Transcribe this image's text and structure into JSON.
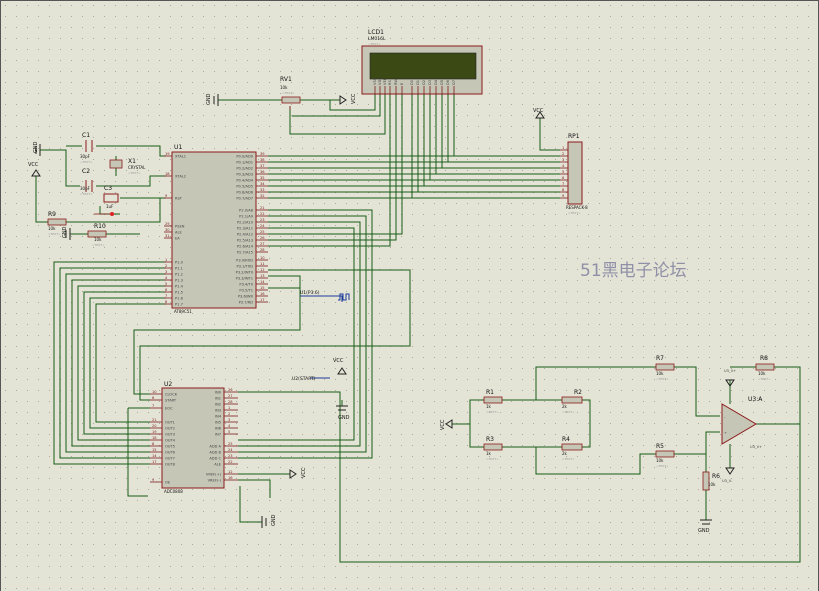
{
  "watermark": "51黑电子论坛",
  "placeholder_hint": "<TEXT>",
  "lcd": {
    "ref": "LCD1",
    "part": "LM016L",
    "pins": [
      "VSS",
      "VDD",
      "VEE",
      "RS",
      "RW",
      "E",
      "D0",
      "D1",
      "D2",
      "D3",
      "D4",
      "D5",
      "D6",
      "D7"
    ]
  },
  "rv1": {
    "ref": "RV1",
    "value": "10k"
  },
  "u1": {
    "ref": "U1",
    "part": "AT89C51",
    "left_pins": [
      {
        "num": "19",
        "name": "XTAL1"
      },
      {
        "num": "18",
        "name": "XTAL2"
      },
      {
        "num": "9",
        "name": "RST"
      },
      {
        "num": "29",
        "name": "PSEN"
      },
      {
        "num": "30",
        "name": "ALE"
      },
      {
        "num": "31",
        "name": "EA"
      },
      {
        "num": "1",
        "name": "P1.0"
      },
      {
        "num": "2",
        "name": "P1.1"
      },
      {
        "num": "3",
        "name": "P1.2"
      },
      {
        "num": "4",
        "name": "P1.3"
      },
      {
        "num": "5",
        "name": "P1.4"
      },
      {
        "num": "6",
        "name": "P1.5"
      },
      {
        "num": "7",
        "name": "P1.6"
      },
      {
        "num": "8",
        "name": "P1.7"
      }
    ],
    "right_pins": [
      {
        "num": "39",
        "name": "P0.0/AD0"
      },
      {
        "num": "38",
        "name": "P0.1/AD1"
      },
      {
        "num": "37",
        "name": "P0.2/AD2"
      },
      {
        "num": "36",
        "name": "P0.3/AD3"
      },
      {
        "num": "35",
        "name": "P0.4/AD4"
      },
      {
        "num": "34",
        "name": "P0.5/AD5"
      },
      {
        "num": "33",
        "name": "P0.6/AD6"
      },
      {
        "num": "32",
        "name": "P0.7/AD7"
      },
      {
        "num": "21",
        "name": "P2.0/A8"
      },
      {
        "num": "22",
        "name": "P2.1/A9"
      },
      {
        "num": "23",
        "name": "P2.2/A10"
      },
      {
        "num": "24",
        "name": "P2.3/A11"
      },
      {
        "num": "25",
        "name": "P2.4/A12"
      },
      {
        "num": "26",
        "name": "P2.5/A13"
      },
      {
        "num": "27",
        "name": "P2.6/A14"
      },
      {
        "num": "28",
        "name": "P2.7/A15"
      },
      {
        "num": "10",
        "name": "P3.0/RXD"
      },
      {
        "num": "11",
        "name": "P3.1/TXD"
      },
      {
        "num": "12",
        "name": "P3.2/INT0"
      },
      {
        "num": "13",
        "name": "P3.3/INT1"
      },
      {
        "num": "14",
        "name": "P3.4/T0"
      },
      {
        "num": "15",
        "name": "P3.5/T1"
      },
      {
        "num": "16",
        "name": "P3.6/WR"
      },
      {
        "num": "17",
        "name": "P3.7/RD"
      }
    ]
  },
  "u2": {
    "ref": "U2",
    "part": "ADC0808",
    "left_pins": [
      {
        "num": "10",
        "name": "CLOCK"
      },
      {
        "num": "6",
        "name": "START"
      },
      {
        "num": "7",
        "name": "EOC"
      },
      {
        "num": "21",
        "name": "OUT1"
      },
      {
        "num": "20",
        "name": "OUT2"
      },
      {
        "num": "19",
        "name": "OUT3"
      },
      {
        "num": "18",
        "name": "OUT4"
      },
      {
        "num": "8",
        "name": "OUT5"
      },
      {
        "num": "15",
        "name": "OUT6"
      },
      {
        "num": "14",
        "name": "OUT7"
      },
      {
        "num": "17",
        "name": "OUT8"
      },
      {
        "num": "9",
        "name": "OE"
      }
    ],
    "right_pins": [
      {
        "num": "26",
        "name": "IN0"
      },
      {
        "num": "27",
        "name": "IN1"
      },
      {
        "num": "28",
        "name": "IN2"
      },
      {
        "num": "1",
        "name": "IN3"
      },
      {
        "num": "2",
        "name": "IN4"
      },
      {
        "num": "3",
        "name": "IN5"
      },
      {
        "num": "4",
        "name": "IN6"
      },
      {
        "num": "5",
        "name": "IN7"
      },
      {
        "num": "25",
        "name": "ADD A"
      },
      {
        "num": "24",
        "name": "ADD B"
      },
      {
        "num": "23",
        "name": "ADD C"
      },
      {
        "num": "22",
        "name": "ALE"
      },
      {
        "num": "12",
        "name": "VREF(+)"
      },
      {
        "num": "16",
        "name": "VREF(-)"
      }
    ]
  },
  "rp1": {
    "ref": "RP1",
    "part": "RESPACK-8",
    "pins": [
      "1",
      "2",
      "3",
      "4",
      "5",
      "6",
      "7",
      "8",
      "9"
    ]
  },
  "components": {
    "c1": {
      "ref": "C1",
      "value": "30pF"
    },
    "c2": {
      "ref": "C2",
      "value": "30pF"
    },
    "c3": {
      "ref": "C3",
      "value": "1uF"
    },
    "x1": {
      "ref": "X1",
      "value": "CRYSTAL"
    },
    "r9": {
      "ref": "R9",
      "value": "10k"
    },
    "r10": {
      "ref": "R10",
      "value": "10k"
    },
    "r1": {
      "ref": "R1",
      "value": "1k"
    },
    "r2": {
      "ref": "R2",
      "value": "2k"
    },
    "r3": {
      "ref": "R3",
      "value": "1k"
    },
    "r4": {
      "ref": "R4",
      "value": "2k"
    },
    "r5": {
      "ref": "R5",
      "value": "10k"
    },
    "r6": {
      "ref": "R6",
      "value": "10k"
    },
    "r7": {
      "ref": "R7",
      "value": "10k"
    },
    "r8": {
      "ref": "R8",
      "value": "10k"
    },
    "u3": {
      "ref": "U3:A",
      "net_top": "U3_V+",
      "net_bottom": "U3_V-",
      "net_out": "U3_V+"
    }
  },
  "power": {
    "vcc": "VCC",
    "gnd": "GND"
  },
  "signals": {
    "u1p3_5": "U1(P3.6)",
    "u2start": "U2(START)"
  }
}
